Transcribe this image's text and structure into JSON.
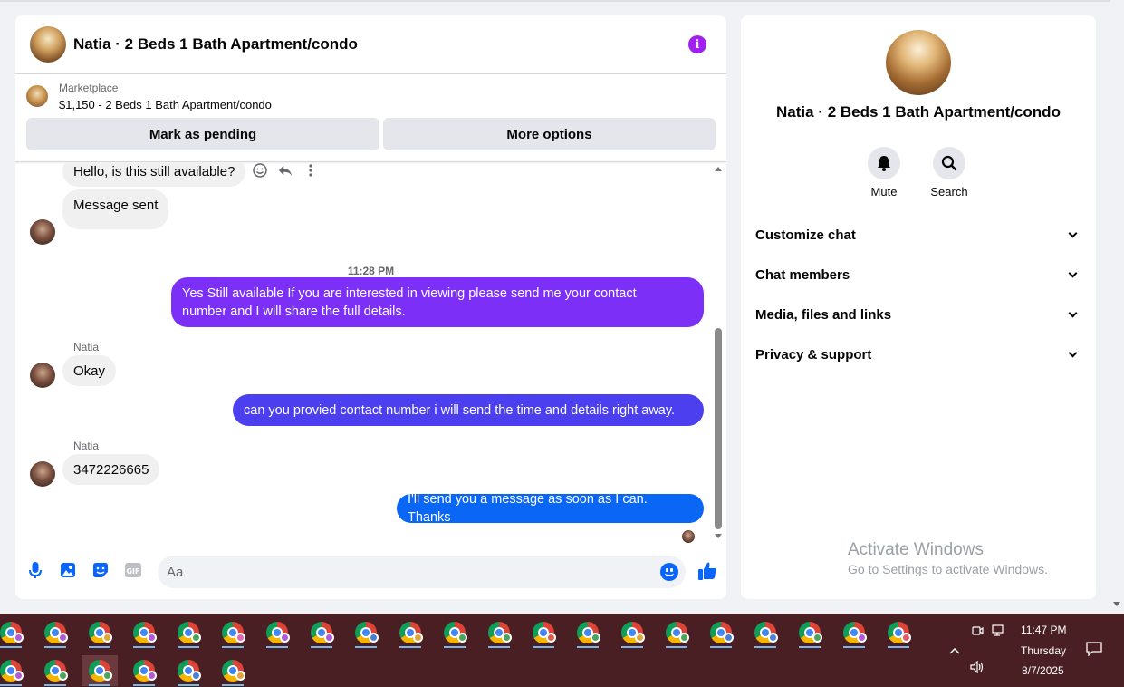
{
  "chat": {
    "title": "Natia · 2 Beds 1 Bath Apartment/condo",
    "listing_source": "Marketplace",
    "listing_desc": "$1,150 - 2 Beds 1 Bath Apartment/condo",
    "mark_pending": "Mark as pending",
    "more_options": "More options",
    "messages": {
      "m1": "Hello, is this still available?",
      "m2": "Message sent",
      "time": "11:28 PM",
      "m3_line1": "Yes Still available If you are interested in viewing please send me your contact",
      "m3_line2": "number and I will share the full details.",
      "sender1": "Natia",
      "m4": "Okay",
      "m5": "can you provied contact number i will send the time and details right away.",
      "sender2": "Natia",
      "m6": "3472226665",
      "m7": "I'll send you a message as soon as I can. Thanks"
    },
    "composer_placeholder": "Aa",
    "colors": {
      "purple": "#7b2ff7",
      "indigo": "#4b3ff0",
      "blue": "#0a66f5"
    }
  },
  "side": {
    "title": "Natia · 2 Beds 1 Bath Apartment/condo",
    "mute": "Mute",
    "search": "Search",
    "menu": [
      "Customize chat",
      "Chat members",
      "Media, files and links",
      "Privacy & support"
    ]
  },
  "watermark": {
    "line1": "Activate Windows",
    "line2": "Go to Settings to activate Windows."
  },
  "taskbar": {
    "time": "11:47 PM",
    "day": "Thursday",
    "date": "8/7/2025",
    "badge_colors": [
      "#b05cd6",
      "#b05cd6",
      "#e0a63a",
      "#b05cd6",
      "#4aa45a",
      "#e06ab0",
      "#b05cd6",
      "#b05cd6",
      "#4a7fd6",
      "#e0a63a",
      "#4aa45a",
      "#4aa45a",
      "#e05a4a",
      "#4aa45a",
      "#e0a63a",
      "#4aa45a",
      "#4a7fd6",
      "#4a7fd6",
      "#4aa45a",
      "#b05cd6",
      "#e05a6a"
    ],
    "row2_badge_colors": [
      "#b05cd6",
      "#4aa45a",
      "#4aa45a",
      "#b05cd6",
      "#4a7fd6",
      "#e0a63a"
    ]
  }
}
